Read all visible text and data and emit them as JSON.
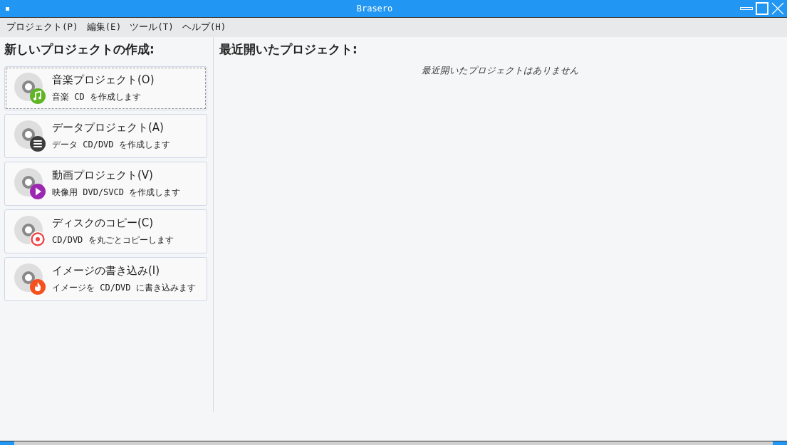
{
  "window": {
    "title": "Brasero"
  },
  "menu": [
    "プロジェクト(P)",
    "編集(E)",
    "ツール(T)",
    "ヘルプ(H)"
  ],
  "new_project": {
    "heading": "新しいプロジェクトの作成:",
    "items": [
      {
        "kind": "audio",
        "title": "音楽プロジェクト(O)",
        "description": "音楽 CD を作成します",
        "selected": true
      },
      {
        "kind": "data",
        "title": "データプロジェクト(A)",
        "description": "データ CD/DVD を作成します",
        "selected": false
      },
      {
        "kind": "video",
        "title": "動画プロジェクト(V)",
        "description": "映像用 DVD/SVCD を作成します",
        "selected": false
      },
      {
        "kind": "copy",
        "title": "ディスクのコピー(C)",
        "description": "CD/DVD を丸ごとコピーします",
        "selected": false
      },
      {
        "kind": "burn",
        "title": "イメージの書き込み(I)",
        "description": "イメージを CD/DVD に書き込みます",
        "selected": false
      }
    ]
  },
  "recent": {
    "heading": "最近開いたプロジェクト:",
    "empty_message": "最近開いたプロジェクトはありません"
  }
}
